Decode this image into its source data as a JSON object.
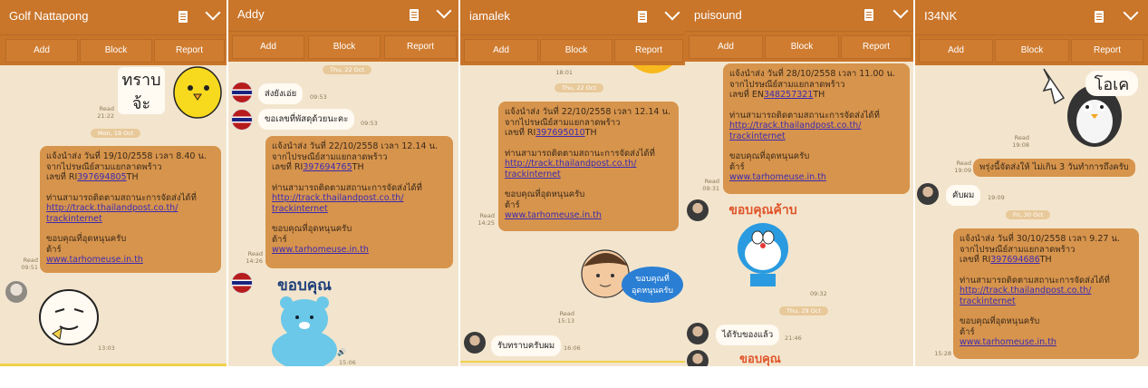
{
  "common": {
    "add": "Add",
    "block": "Block",
    "report": "Report"
  },
  "panels": [
    {
      "title": "Golf Nattapong"
    },
    {
      "title": "Addy"
    },
    {
      "title": "iamalek"
    },
    {
      "title": "puisound"
    },
    {
      "title": "I34NK"
    }
  ],
  "p1": {
    "sticker_text1": "ทราบ",
    "sticker_text2": "จ้ะ",
    "read1": "Read",
    "time1": "21:22",
    "date1": "Mon, 19 Oct",
    "msg": {
      "l1": "แจ้งนำส่ง วันที่ 19/10/2558 เวลา  8.40 น.",
      "l2": "จากไปรษณีย์สามแยกลาดพร้าว",
      "l3a": "เลขที่ RI",
      "l3b": "397694805",
      "l3c": "TH",
      "l4": "ท่านสามารถติดตามสถานะการจัดส่งได้ที่",
      "l5": "http://track.thailandpost.co.th/",
      "l6": "trackinternet",
      "l7": "ขอบคุณที่อุดหนุนครับ",
      "l8": "ต้าร์",
      "l9": "www.tarhomeuse.in.th"
    },
    "read2": "Read",
    "time2": "09:51",
    "time3": "13:03"
  },
  "p2": {
    "date0": "Thu, 22 Oct",
    "m1": "ส่งยังเอ่ย",
    "t1": "09:53",
    "m2": "ขอเลขที่พัสดุด้วยนะคะ",
    "t2": "09:53",
    "msg": {
      "l1": "แจ้งนำส่ง วันที่ 22/10/2558 เวลา 12.14 น.",
      "l2": "จากไปรษณีย์สามแยกลาดพร้าว",
      "l3a": "เลขที่ RI",
      "l3b": "397694765",
      "l3c": "TH",
      "l4": "ท่านสามารถติดตามสถานะการจัดส่งได้ที่",
      "l5": "http://track.thailandpost.co.th/",
      "l6": "trackinternet",
      "l7": "ขอบคุณที่อุดหนุนครับ",
      "l8": "ต้าร์",
      "l9": "www.tarhomeuse.in.th"
    },
    "read": "Read",
    "time": "14:26",
    "sticker_text": "ขอบคุณ",
    "time_last": "15:06"
  },
  "p3": {
    "time0": "18:01",
    "date1": "Thu, 22 Oct",
    "msg": {
      "l1": "แจ้งนำส่ง วันที่ 22/10/2558 เวลา 12.14 น.",
      "l2": "จากไปรษณีย์สามแยกลาดพร้าว",
      "l3a": "เลขที่ RI",
      "l3b": "397695010",
      "l3c": "TH",
      "l4": "ท่านสามารถติดตามสถานะการจัดส่งได้ที่",
      "l5": "http://track.thailandpost.co.th/",
      "l6": "trackinternet",
      "l7": "ขอบคุณที่อุดหนุนครับ",
      "l8": "ต้าร์",
      "l9": "www.tarhomeuse.in.th"
    },
    "read": "Read",
    "time": "14:25",
    "sticker_l1": "ขอบคุณที่",
    "sticker_l2": "อุดหนุนครับ",
    "read2": "Read",
    "time2": "15:13",
    "reply": "รับทราบครับผม",
    "reply_time": "16:06"
  },
  "p4": {
    "msg": {
      "l1": "แจ้งนำส่ง วันที่ 28/10/2558 เวลา 11.00 น.",
      "l2": "จากไปรษณีย์สามแยกลาดพร้าว",
      "l3a": "เลขที่ EN",
      "l3b": "348257321",
      "l3c": "TH",
      "l4": "ท่านสามารถติดตามสถานะการจัดส่งได้ที่",
      "l5": "http://track.thailandpost.co.th/",
      "l6": "trackinternet",
      "l7": "ขอบคุณที่อุดหนุนครับ",
      "l8": "ต้าร์",
      "l9": "www.tarhomeuse.in.th"
    },
    "read": "Read",
    "time": "09:31",
    "sticker_text": "ขอบคุณค้าบ",
    "time2": "09:32",
    "date1": "Thu, 29 Oct",
    "reply": "ได้รับของแล้ว",
    "reply_time": "21:46",
    "sticker2": "ขอบคุณ"
  },
  "p5": {
    "sticker_text": "โอเค",
    "read1": "Read",
    "time1": "19:08",
    "msg1": "พรุ่งนี้จัดส่งให้ ไม่เกิน 3 วันทำการถึงครับ",
    "read2": "Read",
    "time2": "19:09",
    "reply": "คับผม",
    "reply_time": "19:09",
    "date1": "Fri, 30 Oct",
    "msg": {
      "l1": "แจ้งนำส่ง วันที่ 30/10/2558 เวลา 9.27 น.",
      "l2": "จากไปรษณีย์สามแยกลาดพร้าว",
      "l3a": "เลขที่ RI",
      "l3b": "397694686",
      "l3c": "TH",
      "l4": "ท่านสามารถติดตามสถานะการจัดส่งได้ที่",
      "l5": "http://track.thailandpost.co.th/",
      "l6": "trackinternet",
      "l7": "ขอบคุณที่อุดหนุนครับ",
      "l8": "ต้าร์",
      "l9": "www.tarhomeuse.in.th"
    },
    "time3": "15:28"
  }
}
